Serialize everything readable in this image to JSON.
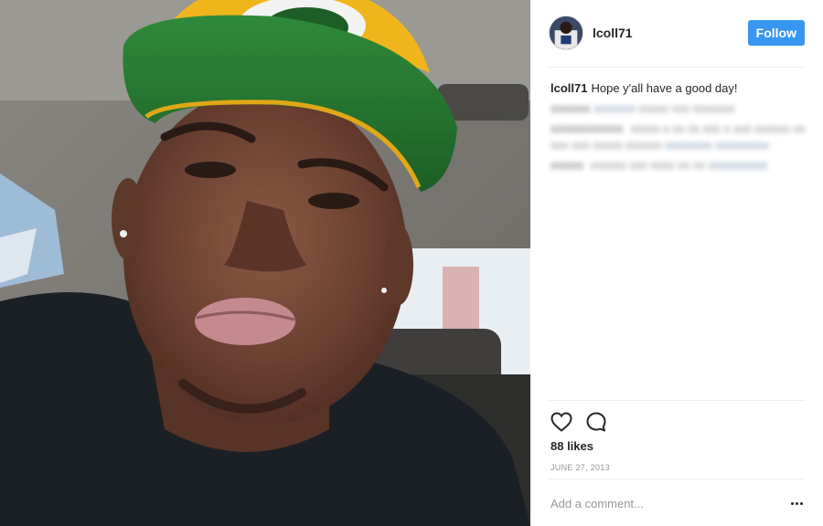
{
  "post": {
    "username": "lcoll71",
    "follow_label": "Follow",
    "likes": "88 likes",
    "date": "JUNE 27, 2013",
    "comment_placeholder": "Add a comment...",
    "caption": {
      "user": "lcoll71",
      "text": "Hope y'all have a good day!"
    }
  },
  "icons": {
    "like": "heart-icon",
    "comment": "speech-bubble-icon",
    "more": "ellipsis-icon"
  },
  "colors": {
    "follow_button": "#3897f0",
    "text": "#262626",
    "muted": "#999999"
  }
}
